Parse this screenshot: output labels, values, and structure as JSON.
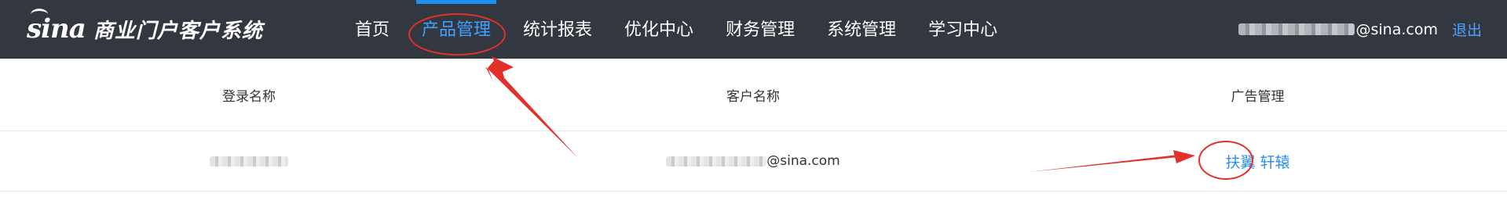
{
  "brand": {
    "logo_mark": "sina",
    "system_name": "商业门户客户系统"
  },
  "nav": {
    "items": [
      {
        "label": "首页",
        "active": false
      },
      {
        "label": "产品管理",
        "active": true
      },
      {
        "label": "统计报表",
        "active": false
      },
      {
        "label": "优化中心",
        "active": false
      },
      {
        "label": "财务管理",
        "active": false
      },
      {
        "label": "系统管理",
        "active": false
      },
      {
        "label": "学习中心",
        "active": false
      }
    ]
  },
  "user": {
    "email_suffix": "@sina.com",
    "logout_label": "退出"
  },
  "table": {
    "headers": [
      "登录名称",
      "客户名称",
      "广告管理"
    ],
    "rows": [
      {
        "customer_suffix": "@sina.com",
        "ad_link": "扶翼 轩辕"
      }
    ]
  },
  "colors": {
    "topbar": "#33373f",
    "accent": "#3ea0ff",
    "link": "#2a8ef0",
    "annotation": "#e3302b"
  }
}
